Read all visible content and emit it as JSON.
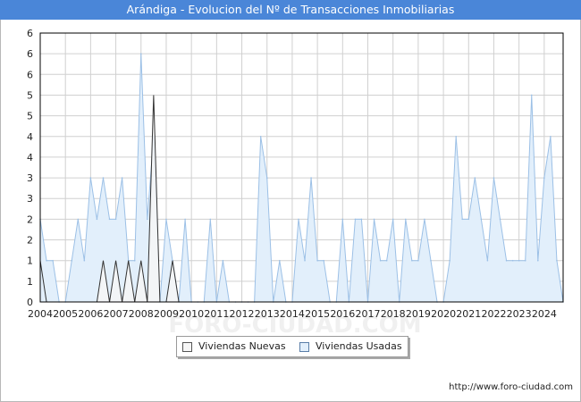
{
  "title": "Arándiga - Evolucion del Nº de Transacciones Inmobiliarias",
  "source": "http://www.foro-ciudad.com",
  "watermark": "FORO-CIUDAD.COM",
  "colors": {
    "header_bg": "#4a86d8",
    "usadas_fill": "#e2effb",
    "usadas_line": "#9cc0e6",
    "nuevas_fill": "#f6f6f6",
    "nuevas_line": "#333333",
    "grid": "#d0d0d0"
  },
  "chart_data": {
    "type": "area",
    "x_axis": {
      "start": 2004.0,
      "end": 2024.75,
      "tick_labels": [
        "2004",
        "2005",
        "2006",
        "2007",
        "2008",
        "2009",
        "2010",
        "2011",
        "2012",
        "2013",
        "2014",
        "2015",
        "2016",
        "2017",
        "2018",
        "2019",
        "2020",
        "2021",
        "2022",
        "2023",
        "2024"
      ]
    },
    "y_axis": {
      "min": 0,
      "max": 6.5,
      "tick_values": [
        0,
        0.5,
        1,
        1.5,
        2,
        2.5,
        3,
        3.5,
        4,
        4.5,
        5,
        5.5,
        6,
        6.5
      ],
      "tick_labels": [
        "0",
        "1",
        "1",
        "2",
        "2",
        "3",
        "3",
        "4",
        "4",
        "5",
        "5",
        "6",
        "6",
        "6"
      ]
    },
    "grid": true,
    "legend_placement": "bottom-center",
    "quarter_step": 0.25,
    "series": [
      {
        "name": "Viviendas Nuevas",
        "key": "nuevas",
        "start": 2004.0,
        "values": [
          1,
          0,
          0,
          0,
          0,
          0,
          0,
          0,
          0,
          0,
          0,
          0,
          0,
          0,
          0,
          0,
          0,
          0,
          0,
          0,
          0,
          0,
          0,
          0,
          0,
          0,
          0,
          0,
          0,
          0,
          0,
          0,
          0,
          0,
          0,
          0,
          0,
          0,
          0,
          0,
          0,
          0,
          0,
          0,
          0,
          0,
          0,
          0,
          0,
          0,
          0,
          0,
          0,
          0,
          0,
          0,
          0,
          0,
          0,
          0,
          0,
          0,
          0,
          0,
          0,
          0,
          0,
          0,
          0,
          0,
          0,
          0,
          0,
          0,
          0,
          0,
          0,
          0,
          0,
          0,
          0,
          0,
          0,
          0,
          0,
          0,
          0,
          0
        ],
        "peaks": [
          {
            "x": 2006.5,
            "y": 1
          },
          {
            "x": 2007.0,
            "y": 1
          },
          {
            "x": 2007.5,
            "y": 1
          },
          {
            "x": 2008.0,
            "y": 1
          },
          {
            "x": 2008.5,
            "y": 5
          },
          {
            "x": 2009.25,
            "y": 1
          }
        ]
      },
      {
        "name": "Viviendas Usadas",
        "key": "usadas",
        "points": [
          [
            2004.0,
            2
          ],
          [
            2004.25,
            1
          ],
          [
            2004.5,
            1
          ],
          [
            2004.75,
            0
          ],
          [
            2005.0,
            0
          ],
          [
            2005.25,
            1
          ],
          [
            2005.5,
            2
          ],
          [
            2005.75,
            1
          ],
          [
            2006.0,
            3
          ],
          [
            2006.25,
            2
          ],
          [
            2006.5,
            3
          ],
          [
            2006.75,
            2
          ],
          [
            2007.0,
            2
          ],
          [
            2007.25,
            3
          ],
          [
            2007.5,
            1
          ],
          [
            2007.75,
            1
          ],
          [
            2008.0,
            6
          ],
          [
            2008.25,
            2
          ],
          [
            2008.5,
            4
          ],
          [
            2008.75,
            0
          ],
          [
            2009.0,
            2
          ],
          [
            2009.25,
            1
          ],
          [
            2009.5,
            0
          ],
          [
            2009.75,
            2
          ],
          [
            2010.0,
            0
          ],
          [
            2010.25,
            0
          ],
          [
            2010.5,
            0
          ],
          [
            2010.75,
            2
          ],
          [
            2011.0,
            0
          ],
          [
            2011.25,
            1
          ],
          [
            2011.5,
            0
          ],
          [
            2011.75,
            0
          ],
          [
            2012.0,
            0
          ],
          [
            2012.25,
            0
          ],
          [
            2012.5,
            0
          ],
          [
            2012.75,
            4
          ],
          [
            2013.0,
            3
          ],
          [
            2013.25,
            0
          ],
          [
            2013.5,
            1
          ],
          [
            2013.75,
            0
          ],
          [
            2014.0,
            0
          ],
          [
            2014.25,
            2
          ],
          [
            2014.5,
            1
          ],
          [
            2014.75,
            3
          ],
          [
            2015.0,
            1
          ],
          [
            2015.25,
            1
          ],
          [
            2015.5,
            0
          ],
          [
            2015.75,
            0
          ],
          [
            2016.0,
            2
          ],
          [
            2016.25,
            0
          ],
          [
            2016.5,
            2
          ],
          [
            2016.75,
            2
          ],
          [
            2017.0,
            0
          ],
          [
            2017.25,
            2
          ],
          [
            2017.5,
            1
          ],
          [
            2017.75,
            1
          ],
          [
            2018.0,
            2
          ],
          [
            2018.25,
            0
          ],
          [
            2018.5,
            2
          ],
          [
            2018.75,
            1
          ],
          [
            2019.0,
            1
          ],
          [
            2019.25,
            2
          ],
          [
            2019.5,
            1
          ],
          [
            2019.75,
            0
          ],
          [
            2020.0,
            0
          ],
          [
            2020.25,
            1
          ],
          [
            2020.5,
            4
          ],
          [
            2020.75,
            2
          ],
          [
            2021.0,
            2
          ],
          [
            2021.25,
            3
          ],
          [
            2021.5,
            2
          ],
          [
            2021.75,
            1
          ],
          [
            2022.0,
            3
          ],
          [
            2022.25,
            2
          ],
          [
            2022.5,
            1
          ],
          [
            2022.75,
            1
          ],
          [
            2023.0,
            1
          ],
          [
            2023.25,
            1
          ],
          [
            2023.5,
            5
          ],
          [
            2023.75,
            1
          ],
          [
            2024.0,
            3
          ],
          [
            2024.25,
            4
          ],
          [
            2024.5,
            1
          ],
          [
            2024.75,
            0
          ]
        ]
      }
    ]
  },
  "legend": {
    "items": [
      {
        "label": "Viviendas Nuevas"
      },
      {
        "label": "Viviendas Usadas"
      }
    ]
  }
}
